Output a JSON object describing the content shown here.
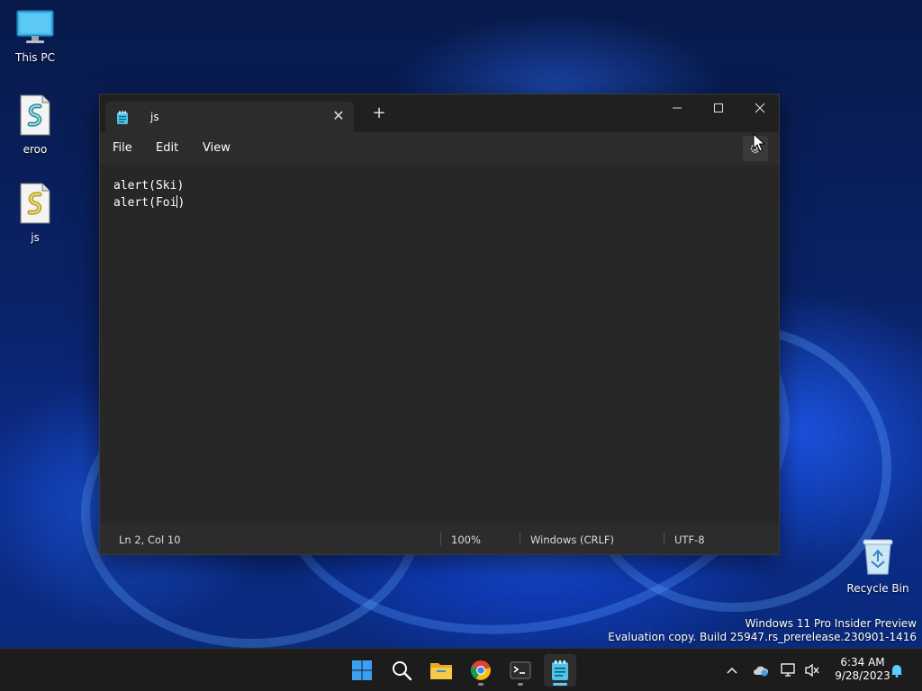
{
  "desktop": {
    "icons": [
      {
        "label": "This PC",
        "icon": "monitor-icon"
      },
      {
        "label": "eroo",
        "icon": "script-file-icon"
      },
      {
        "label": "js",
        "icon": "script-file-icon"
      },
      {
        "label": "Recycle Bin",
        "icon": "recycle-bin-icon"
      }
    ],
    "watermark": {
      "line1": "Windows 11 Pro Insider Preview",
      "line2": "Evaluation copy. Build 25947.rs_prerelease.230901-1416"
    }
  },
  "notepad": {
    "tab_title": "js",
    "menu": [
      "File",
      "Edit",
      "View"
    ],
    "lines": [
      "alert(Ski)",
      "alert(Foi",
      ")"
    ],
    "status": {
      "position": "Ln 2, Col 10",
      "zoom": "100%",
      "line_ending": "Windows (CRLF)",
      "encoding": "UTF-8"
    }
  },
  "taskbar": {
    "apps": [
      "start-icon",
      "search-icon",
      "file-explorer-icon",
      "chrome-icon",
      "terminal-icon",
      "notepad-icon"
    ],
    "clock": {
      "time": "6:34 AM",
      "date": "9/28/2023"
    }
  },
  "colors": {
    "accent": "#60cdff",
    "window_bg": "#272727",
    "titlebar_bg": "#202020",
    "taskbar_bg": "#1c1c1c"
  }
}
